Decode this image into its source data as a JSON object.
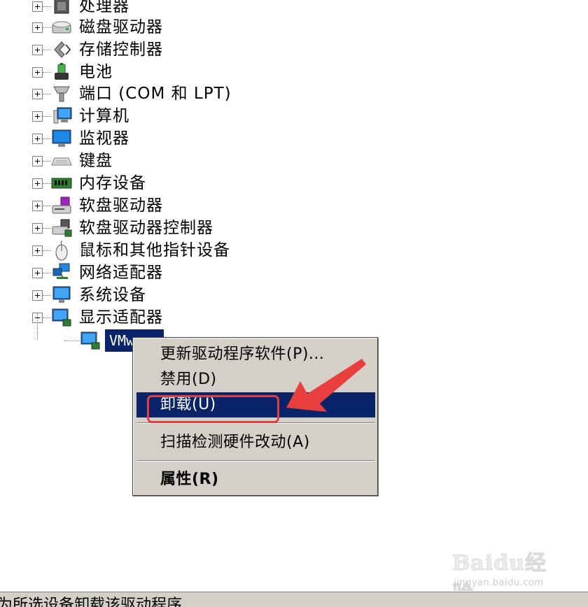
{
  "tree": {
    "items": [
      {
        "label": "处理器",
        "icon": "processor-icon",
        "expanded": false
      },
      {
        "label": "磁盘驱动器",
        "icon": "disk-drive-icon",
        "expanded": false
      },
      {
        "label": "存储控制器",
        "icon": "storage-controller-icon",
        "expanded": false
      },
      {
        "label": "电池",
        "icon": "battery-icon",
        "expanded": false
      },
      {
        "label": "端口 (COM 和 LPT)",
        "icon": "port-icon",
        "expanded": false
      },
      {
        "label": "计算机",
        "icon": "computer-icon",
        "expanded": false
      },
      {
        "label": "监视器",
        "icon": "monitor-icon",
        "expanded": false
      },
      {
        "label": "键盘",
        "icon": "keyboard-icon",
        "expanded": false
      },
      {
        "label": "内存设备",
        "icon": "memory-device-icon",
        "expanded": false
      },
      {
        "label": "软盘驱动器",
        "icon": "floppy-drive-icon",
        "expanded": false
      },
      {
        "label": "软盘驱动器控制器",
        "icon": "floppy-controller-icon",
        "expanded": false
      },
      {
        "label": "鼠标和其他指针设备",
        "icon": "mouse-icon",
        "expanded": false
      },
      {
        "label": "网络适配器",
        "icon": "network-adapter-icon",
        "expanded": false
      },
      {
        "label": "系统设备",
        "icon": "system-device-icon",
        "expanded": false
      },
      {
        "label": "显示适配器",
        "icon": "display-adapter-icon",
        "expanded": true
      }
    ],
    "selected_child": {
      "label": "VMw...",
      "icon": "display-adapter-icon"
    }
  },
  "context_menu": {
    "items": [
      {
        "label": "更新驱动程序软件(P)...",
        "highlighted": false,
        "bold": false
      },
      {
        "label": "禁用(D)",
        "highlighted": false,
        "bold": false
      },
      {
        "label": "卸载(U)",
        "highlighted": true,
        "bold": false
      },
      {
        "label": "扫描检测硬件改动(A)",
        "highlighted": false,
        "bold": false
      },
      {
        "label": "属性(R)",
        "highlighted": false,
        "bold": true
      }
    ]
  },
  "annotation": {
    "color": "#e83e3e"
  },
  "watermark": {
    "brand": "Baidu经验",
    "site": "jingyan.baidu.com"
  },
  "status_bar": {
    "text": "为所选设备卸载该驱动程序"
  },
  "colors": {
    "selection": "#0a246a",
    "menu_bg": "#d4d0c8"
  }
}
